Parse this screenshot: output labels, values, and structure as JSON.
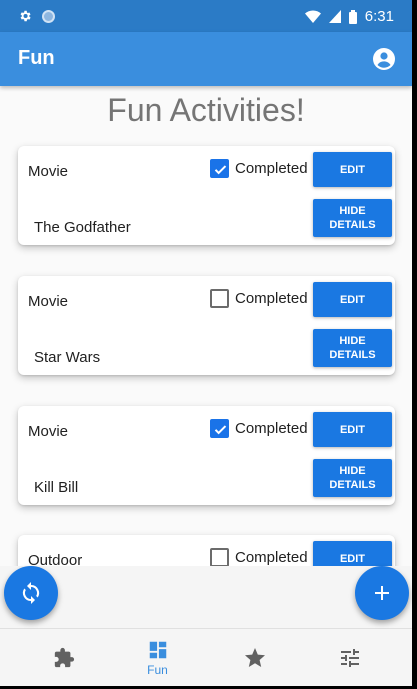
{
  "status": {
    "time": "6:31"
  },
  "app": {
    "title": "Fun"
  },
  "page": {
    "title": "Fun Activities!"
  },
  "cards": [
    {
      "category": "Movie",
      "name": "The Godfather",
      "completed": true,
      "checkbox_label": "Completed",
      "edit_label": "EDIT",
      "hide_label_line1": "HIDE",
      "hide_label_line2": "DETAILS"
    },
    {
      "category": "Movie",
      "name": "Star Wars",
      "completed": false,
      "checkbox_label": "Completed",
      "edit_label": "EDIT",
      "hide_label_line1": "HIDE",
      "hide_label_line2": "DETAILS"
    },
    {
      "category": "Movie",
      "name": "Kill Bill",
      "completed": true,
      "checkbox_label": "Completed",
      "edit_label": "EDIT",
      "hide_label_line1": "HIDE",
      "hide_label_line2": "DETAILS"
    },
    {
      "category": "Outdoor",
      "completed": false,
      "checkbox_label": "Completed",
      "edit_label": "EDIT"
    }
  ],
  "bottom_nav": {
    "items": [
      {
        "icon": "puzzle-icon",
        "label": ""
      },
      {
        "icon": "dashboard-icon",
        "label": "Fun",
        "active": true
      },
      {
        "icon": "star-icon",
        "label": ""
      },
      {
        "icon": "sliders-icon",
        "label": ""
      }
    ]
  },
  "colors": {
    "appbar": "#3a8ede",
    "statusbar": "#2b7bc6",
    "accent": "#1a78e2",
    "active_nav": "#3a8ede",
    "inactive_icon": "#616161"
  }
}
